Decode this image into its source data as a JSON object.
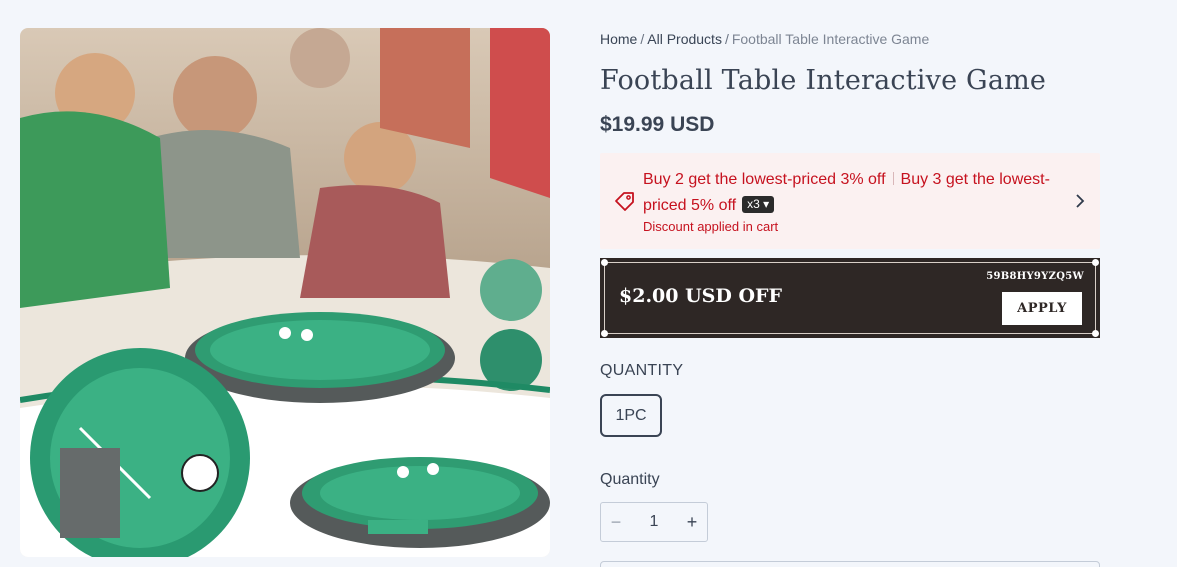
{
  "breadcrumb": {
    "home": "Home",
    "separator": "/",
    "collection": "All Products",
    "current": "Football Table Interactive Game"
  },
  "product": {
    "title": "Football Table Interactive Game",
    "price": "$19.99 USD"
  },
  "promotion": {
    "offer_1": "Buy 2 get the lowest-priced 3% off",
    "offer_2": "Buy 3 get the lowest-priced 5% off",
    "multiplier": "x3",
    "note": "Discount applied in cart",
    "icon": "tag-icon",
    "color": "#c6121f"
  },
  "coupon": {
    "amount": "$2.00 USD OFF",
    "code": "59B8HY9YZQ5W",
    "apply_label": "APPLY"
  },
  "options": {
    "label": "QUANTITY",
    "selected": "1PC"
  },
  "quantity": {
    "label": "Quantity",
    "value": "1",
    "minus": "−",
    "plus": "+"
  },
  "colors": {
    "accent": "#c6121f",
    "coupon_bg": "#2e2725",
    "page_bg": "#f3f6fb"
  }
}
